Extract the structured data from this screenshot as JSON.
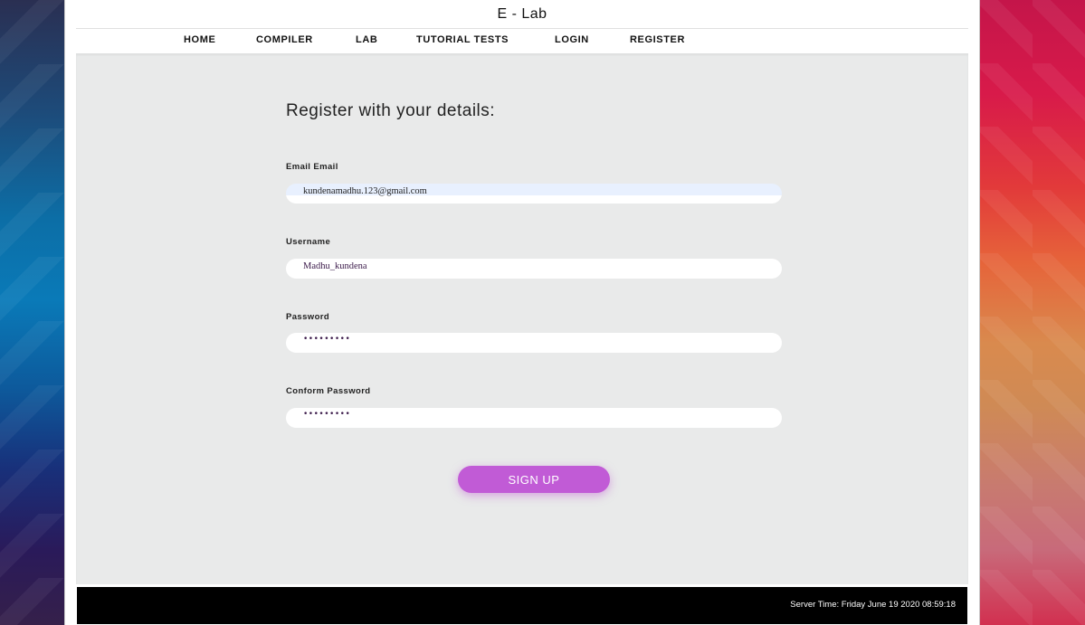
{
  "header": {
    "brand": "E - Lab"
  },
  "nav": {
    "items": [
      {
        "label": "HOME"
      },
      {
        "label": "COMPILER"
      },
      {
        "label": "LAB"
      },
      {
        "label": "TUTORIAL TESTS"
      },
      {
        "label": "LOGIN"
      },
      {
        "label": "REGISTER"
      }
    ]
  },
  "form": {
    "heading": "Register with your details:",
    "email": {
      "label": "Email Email",
      "value": "kundenamadhu.123@gmail.com"
    },
    "username": {
      "label": "Username",
      "value": "Madhu_kundena"
    },
    "password": {
      "label": "Password",
      "value": "•••••••••"
    },
    "confirm": {
      "label": "Conform Password",
      "value": "•••••••••"
    },
    "submit_label": "SIGN UP"
  },
  "footer": {
    "server_time": "Server Time: Friday June 19 2020 08:59:18"
  },
  "colors": {
    "accent": "#c15bd6",
    "content_bg": "#e9eaea",
    "footer_bg": "#000000"
  }
}
